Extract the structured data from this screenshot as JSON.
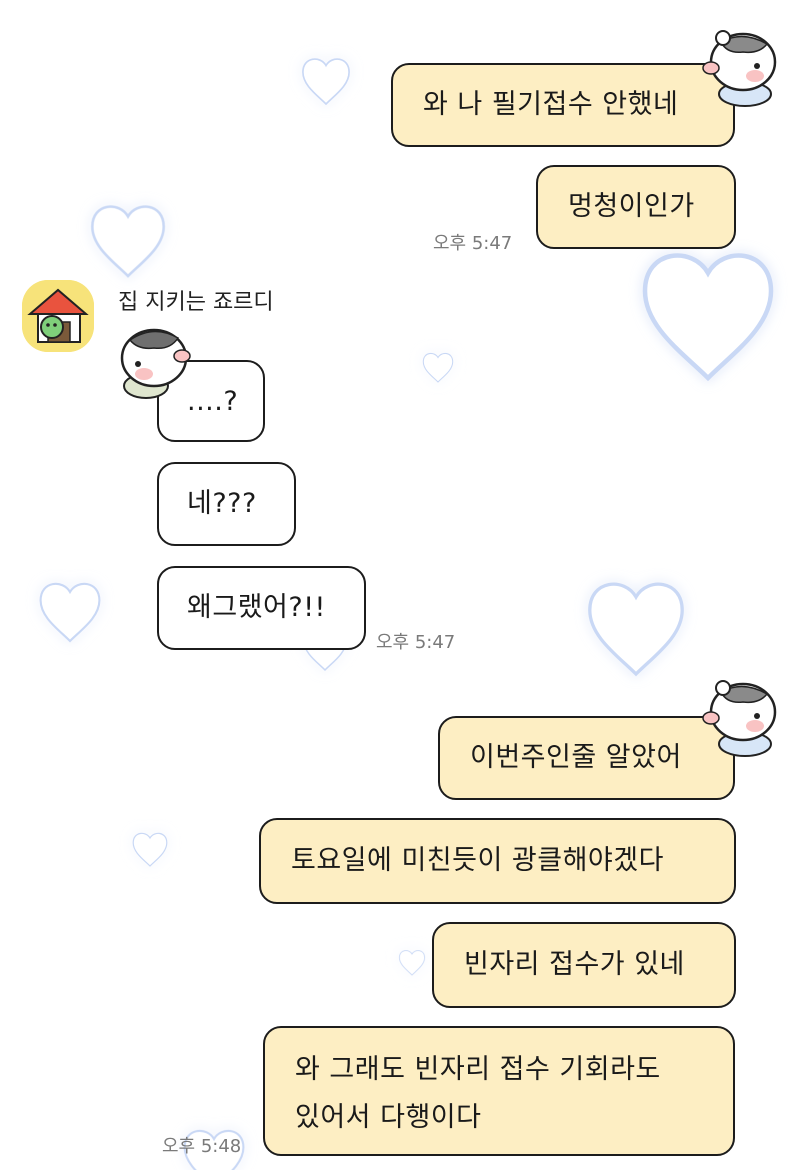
{
  "chat": {
    "sender_name": "집 지키는 죠르디",
    "messages": [
      {
        "text": "와 나 필기접수 안했네",
        "from": "me"
      },
      {
        "text": "멍청이인가",
        "from": "me",
        "time": "오후 5:47"
      },
      {
        "text": "....?",
        "from": "them"
      },
      {
        "text": "네???",
        "from": "them"
      },
      {
        "text": "왜그랬어?!!",
        "from": "them",
        "time": "오후 5:47"
      },
      {
        "text": "이번주인줄 알았어",
        "from": "me"
      },
      {
        "text": "토요일에 미친듯이 광클해야겠다",
        "from": "me"
      },
      {
        "text": "빈자리 접수가 있네",
        "from": "me"
      },
      {
        "lines": [
          "와 그래도 빈자리 접수 기회라도",
          "있어서 다행이다"
        ],
        "from": "me",
        "time": "오후 5:48"
      }
    ]
  },
  "icons": {
    "avatar": "jordy-house-avatar-icon",
    "sticker": "hamster-sticker-icon",
    "background": "heart-outline-icon"
  },
  "colors": {
    "my_bubble": "#fdeec3",
    "their_bubble": "#ffffff",
    "bubble_border": "#1c1c1c",
    "heart_glow": "#c9d8f5",
    "time_text": "#7a7a7a"
  }
}
